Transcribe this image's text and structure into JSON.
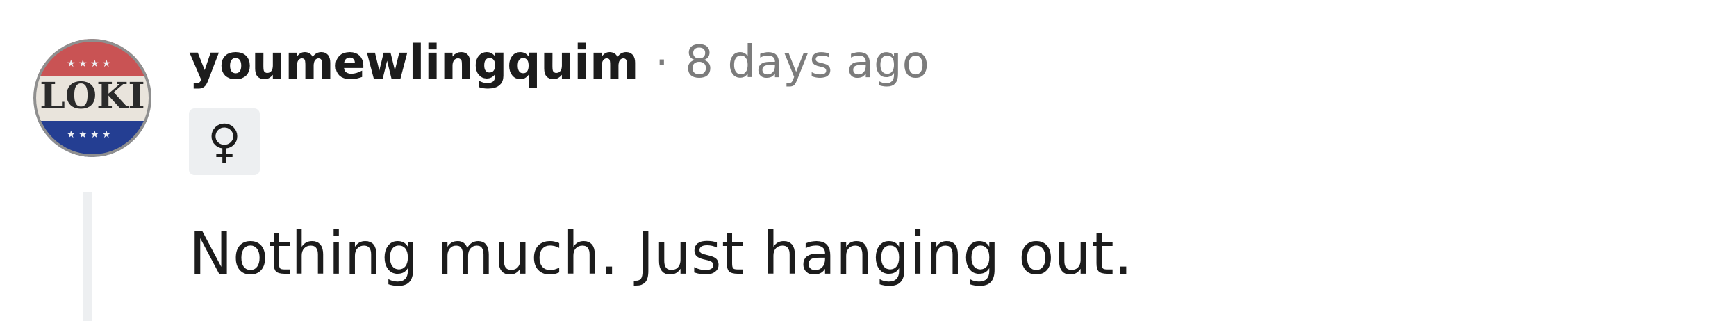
{
  "comment": {
    "avatar": {
      "badge_text": "LOKI",
      "colors": {
        "top": "#c95354",
        "middle": "#e9e4dc",
        "bottom": "#243e92",
        "star": "#eef0f4",
        "text": "#2b2b2b"
      }
    },
    "author": "youmewlingquim",
    "separator": "·",
    "timestamp": "8 days ago",
    "flair": "♀",
    "body": "Nothing much. Just hanging out."
  }
}
